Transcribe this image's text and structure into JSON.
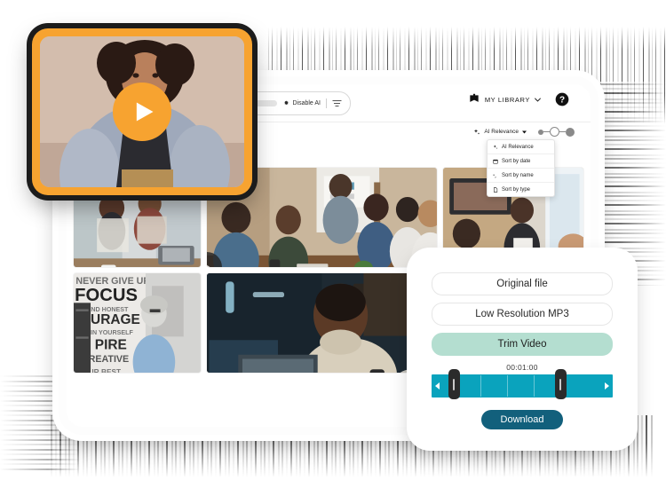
{
  "app": {
    "searchbar": {
      "placeholder": "",
      "disable_ai_label": "Disable AI",
      "gear_icon": "gear-icon",
      "filter_icon": "filter-sliders-icon"
    },
    "header": {
      "library_label": "MY LIBRARY",
      "book_icon": "book-icon",
      "chevron_icon": "chevron-down-icon",
      "help_icon": "help-question-icon"
    },
    "sort": {
      "selected": "AI Relevance",
      "sparkle_icon": "ai-sparkle-icon",
      "caret_icon": "caret-down-icon",
      "menu_items": [
        {
          "label": "AI Relevance",
          "icon": "ai-sparkle-icon"
        },
        {
          "label": "Sort by date",
          "icon": "calendar-icon"
        },
        {
          "label": "Sort by name",
          "icon": "alpha-sort-icon"
        },
        {
          "label": "Sort by type",
          "icon": "file-type-icon"
        }
      ]
    },
    "size_slider": {
      "small_label": "small-thumbnails",
      "medium_label": "medium-thumbnails",
      "large_label": "large-thumbnails"
    },
    "grid": {
      "items": [
        {
          "name": "thumbnail-office-newspaper",
          "kind": "image"
        },
        {
          "name": "thumbnail-team-meeting",
          "kind": "video"
        },
        {
          "name": "thumbnail-conference-room",
          "kind": "image"
        },
        {
          "name": "thumbnail-focus-wall-phone-call",
          "kind": "image"
        },
        {
          "name": "thumbnail-man-laptop-smiling",
          "kind": "image"
        },
        {
          "name": "thumbnail-partial-right",
          "kind": "image"
        }
      ]
    }
  },
  "video_card": {
    "name": "video-preview-card",
    "play_icon": "play-triangle-icon",
    "accent": "#f7a330"
  },
  "trim_panel": {
    "options": [
      {
        "label": "Original file",
        "highlight": false
      },
      {
        "label": "Low Resolution MP3",
        "highlight": false
      },
      {
        "label": "Trim Video",
        "highlight": true
      }
    ],
    "timestamp": "00:01:00",
    "download_label": "Download",
    "left_arrow_icon": "arrow-left-icon",
    "right_arrow_icon": "arrow-right-icon",
    "track_color": "#0aa3bd",
    "download_color": "#12607c",
    "trim_highlight_color": "#b4ded0"
  }
}
